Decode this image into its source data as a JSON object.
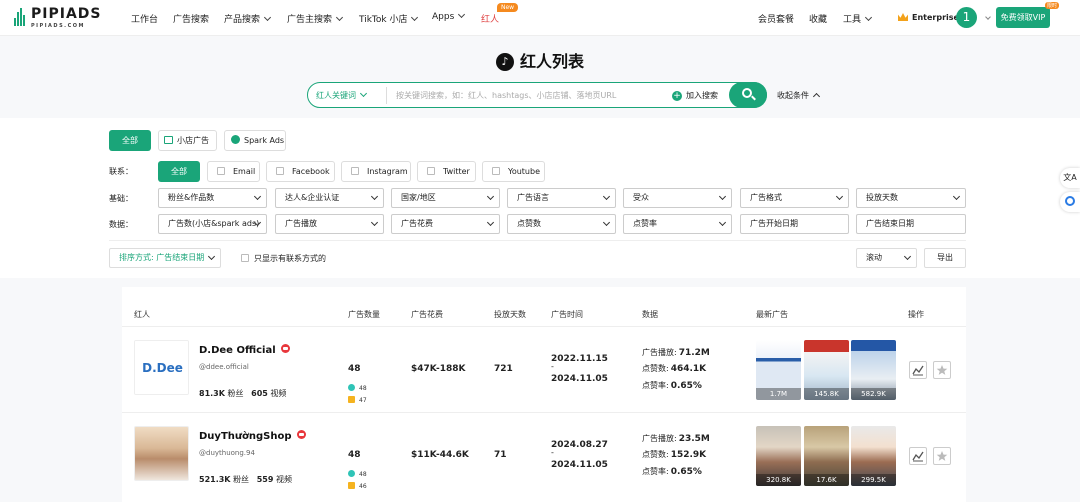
{
  "brand": {
    "name": "PIPIADS",
    "tagline": "PIPIADS.COM"
  },
  "nav": {
    "items": [
      "工作台",
      "广告搜索",
      "产品搜索",
      "广告主搜索",
      "TikTok 小店",
      "Apps",
      "红人"
    ],
    "new_badge": "New",
    "right": [
      "会员套餐",
      "收藏",
      "工具"
    ],
    "plan": "Enterprise",
    "avatar": "1",
    "vip_button": "免费领取VIP",
    "vip_badge": "限时"
  },
  "page": {
    "title": "红人列表"
  },
  "search": {
    "mode": "红人关键词",
    "placeholder": "按关键词搜索，如：红人、hashtags、小店店铺、落地页URL",
    "add_label": "加入搜索",
    "collapse_label": "收起条件"
  },
  "filters": {
    "type_tabs": [
      "全部",
      "小店广告",
      "Spark Ads"
    ],
    "contact_label": "联系：",
    "contacts": [
      "全部",
      "Email",
      "Facebook",
      "Instagram",
      "Twitter",
      "Youtube"
    ],
    "basic_label": "基础：",
    "basic": [
      "粉丝&作品数",
      "达人&企业认证",
      "国家/地区",
      "广告语言",
      "受众",
      "广告格式",
      "投放天数"
    ],
    "data_label": "数据：",
    "data": [
      "广告数(小店&spark ads)",
      "广告播放",
      "广告花费",
      "点赞数",
      "点赞率",
      "广告开始日期",
      "广告结束日期"
    ],
    "sort": "排序方式: 广告结束日期",
    "only_contact": "只显示有联系方式的",
    "scroll": "滚动",
    "export": "导出"
  },
  "table": {
    "headers": [
      "红人",
      "广告数量",
      "广告花费",
      "投放天数",
      "广告时间",
      "数据",
      "最新广告",
      "操作"
    ],
    "metric_labels": [
      "广告播放:",
      "点赞数:",
      "点赞率:"
    ],
    "fans_label": "粉丝",
    "videos_label": "视频",
    "rows": [
      {
        "name": "D.Dee Official",
        "handle": "@ddee.official",
        "avatar_text": "D.Dee",
        "fans": "81.3K",
        "videos": "605",
        "ad_count": "48",
        "shop_ads": "48",
        "spark_ads": "47",
        "spend": "$47K-188K",
        "days": "721",
        "start": "2022.11.15",
        "end": "2024.11.05",
        "plays": "71.2M",
        "likes": "464.1K",
        "like_rate": "0.65%",
        "ads": [
          "1.7M",
          "145.8K",
          "582.9K"
        ]
      },
      {
        "name": "DuyThườngShop",
        "handle": "@duythuong.94",
        "fans": "521.3K",
        "videos": "559",
        "ad_count": "48",
        "shop_ads": "48",
        "spark_ads": "46",
        "spend": "$11K-44.6K",
        "days": "71",
        "start": "2024.08.27",
        "end": "2024.11.05",
        "plays": "23.5M",
        "likes": "152.9K",
        "like_rate": "0.65%",
        "ads": [
          "320.8K",
          "17.6K",
          "299.5K"
        ]
      }
    ]
  },
  "side": {
    "translate": "文A"
  }
}
